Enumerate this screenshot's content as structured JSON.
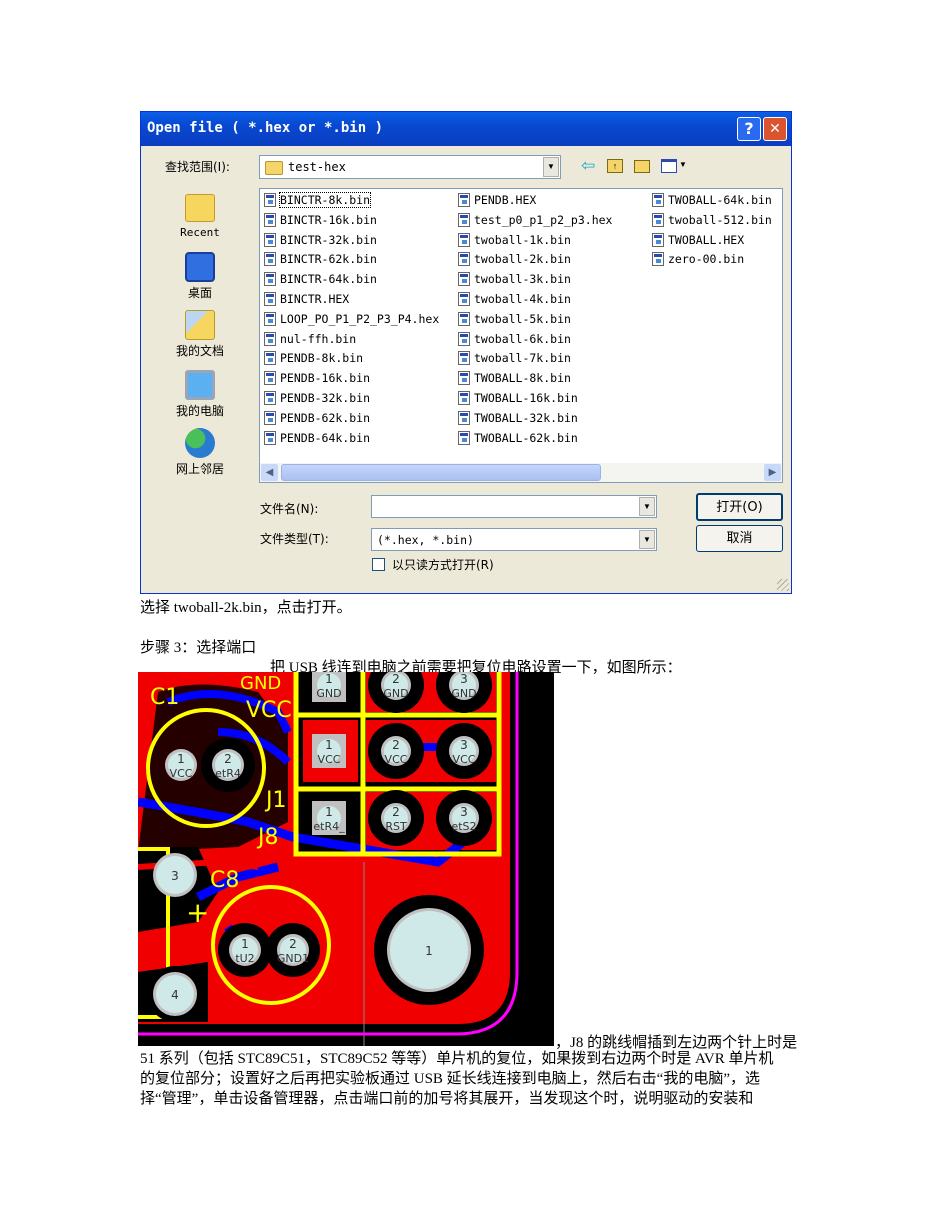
{
  "dialog": {
    "title": "Open file ( *.hex or *.bin )",
    "help_label": "?",
    "close_label": "✕",
    "lookin_label": "查找范围(I):",
    "lookin_value": "test-hex",
    "places": [
      {
        "label": "Recent",
        "icon": "recent-folder-icon"
      },
      {
        "label": "桌面",
        "icon": "desktop-icon"
      },
      {
        "label": "我的文档",
        "icon": "my-documents-icon"
      },
      {
        "label": "我的电脑",
        "icon": "my-computer-icon"
      },
      {
        "label": "网上邻居",
        "icon": "network-places-icon"
      }
    ],
    "files_col1": [
      "BINCTR-8k.bin",
      "BINCTR-16k.bin",
      "BINCTR-32k.bin",
      "BINCTR-62k.bin",
      "BINCTR-64k.bin",
      "BINCTR.HEX",
      "LOOP_PO_P1_P2_P3_P4.hex",
      "nul-ffh.bin",
      "PENDB-8k.bin",
      "PENDB-16k.bin",
      "PENDB-32k.bin",
      "PENDB-62k.bin",
      "PENDB-64k.bin"
    ],
    "files_col2": [
      "PENDB.HEX",
      "test_p0_p1_p2_p3.hex",
      "twoball-1k.bin",
      "twoball-2k.bin",
      "twoball-3k.bin",
      "twoball-4k.bin",
      "twoball-5k.bin",
      "twoball-6k.bin",
      "twoball-7k.bin",
      "TWOBALL-8k.bin",
      "TWOBALL-16k.bin",
      "TWOBALL-32k.bin",
      "TWOBALL-62k.bin"
    ],
    "files_col3": [
      "TWOBALL-64k.bin",
      "twoball-512.bin",
      "TWOBALL.HEX",
      "zero-00.bin"
    ],
    "filename_label": "文件名(N):",
    "filename_value": "",
    "filetype_label": "文件类型(T):",
    "filetype_value": "(*.hex, *.bin)",
    "readonly_label": "以只读方式打开(R)",
    "readonly_checked": false,
    "open_label": "打开(O)",
    "cancel_label": "取消"
  },
  "doc": {
    "line1": "选择 twoball-2k.bin，点击打开。",
    "step3": "步骤 3：选择端口",
    "intro": "把 USB 线连到电脑之前需要把复位电路设置一下，如图所示：",
    "para_first": "，J8 的跳线帽插到左边两个针上时是",
    "para_lines": [
      "51 系列（包括 STC89C51，STC89C52 等等）单片机的复位，如果拨到右边两个时是 AVR 单片机",
      "的复位部分；设置好之后再把实验板通过 USB 延长线连接到电脑上，然后右击“我的电脑”，选",
      "择“管理”，单击设备管理器，点击端口前的加号将其展开，当发现这个时，说明驱动的安装和"
    ]
  },
  "pcb": {
    "labels": {
      "c1": "C1",
      "vcc": "VCC",
      "j1": "J1",
      "j8": "J8",
      "c8": "C8",
      "plus": "+",
      "gnd_top": "GND"
    },
    "header_pads": [
      {
        "num": "1",
        "net": "GND"
      },
      {
        "num": "2",
        "net": "GND"
      },
      {
        "num": "3",
        "net": "GND"
      },
      {
        "num": "1",
        "net": "VCC"
      },
      {
        "num": "2",
        "net": "VCC"
      },
      {
        "num": "3",
        "net": "VCC"
      },
      {
        "num": "1",
        "net": "etR4_"
      },
      {
        "num": "2",
        "net": "RST"
      },
      {
        "num": "3",
        "net": "etS2"
      }
    ],
    "c1_pads": [
      {
        "num": "1",
        "net": "VCC"
      },
      {
        "num": "2",
        "net": "etR4"
      }
    ],
    "c8_pads": [
      {
        "num": "1",
        "net": "tU2"
      },
      {
        "num": "2",
        "net": "GND1"
      }
    ],
    "misc_pads": [
      "3",
      "4",
      "1"
    ]
  },
  "colors": {
    "titlebar": "#0a4ed8",
    "board": "#f00000",
    "silk": "#ffff00",
    "pad": "#cfe8e8",
    "outline": "#ff00ff",
    "trace": "#0000ff"
  }
}
